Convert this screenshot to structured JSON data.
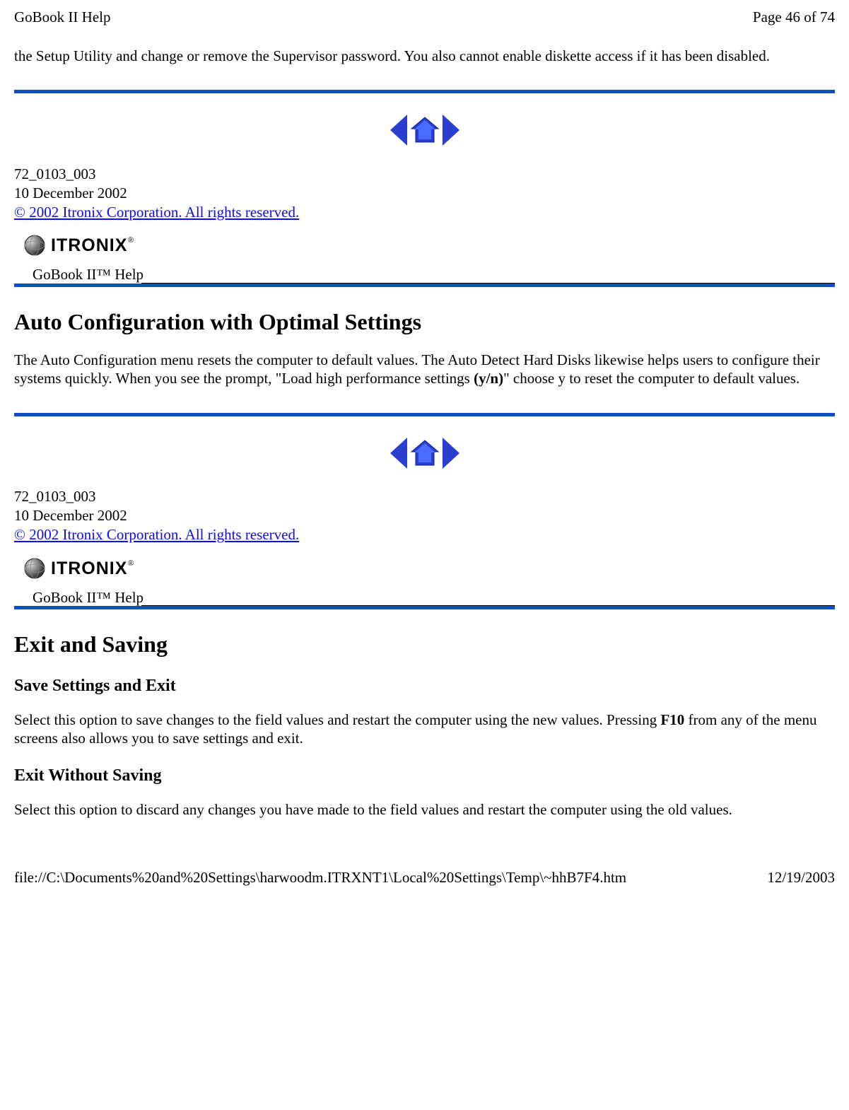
{
  "header": {
    "title": "GoBook II Help",
    "page_info": "Page 46 of 74"
  },
  "intro_sentence": "the Setup Utility and change or remove the Supervisor password.  You also cannot enable diskette access if it has been disabled.",
  "doc_meta": {
    "doc_id": "72_0103_003",
    "date": "10 December 2002",
    "copyright_link": "© 2002 Itronix Corporation.  All rights reserved."
  },
  "product_label": "GoBook II™ Help",
  "logo_text": "ITRONIX",
  "logo_reg": "®",
  "section1": {
    "title": "Auto Configuration with Optimal Settings",
    "body_pre": "The Auto Configuration menu resets the computer to default values.  The Auto Detect Hard Disks likewise helps users to configure their systems quickly.  When you see the prompt, \"Load high performance settings ",
    "body_bold": "(y/n)",
    "body_post": "\" choose y to reset the computer to default values."
  },
  "section2": {
    "title": "Exit and Saving",
    "sub1_title": "Save Settings and Exit",
    "sub1_text_pre": "Select this option to save changes to the field values and restart the computer using the new values.  Pressing ",
    "sub1_text_bold": "F10",
    "sub1_text_post": " from any of the menu screens also allows you to save settings and exit.",
    "sub2_title": "Exit Without Saving",
    "sub2_text": "Select this option to discard any changes you have made to the field values and restart the computer using the old values."
  },
  "footer": {
    "path": "file://C:\\Documents%20and%20Settings\\harwoodm.ITRXNT1\\Local%20Settings\\Temp\\~hhB7F4.htm",
    "date": "12/19/2003"
  },
  "icons": {
    "prev": "prev-arrow-icon",
    "home": "home-icon",
    "next": "next-arrow-icon"
  }
}
